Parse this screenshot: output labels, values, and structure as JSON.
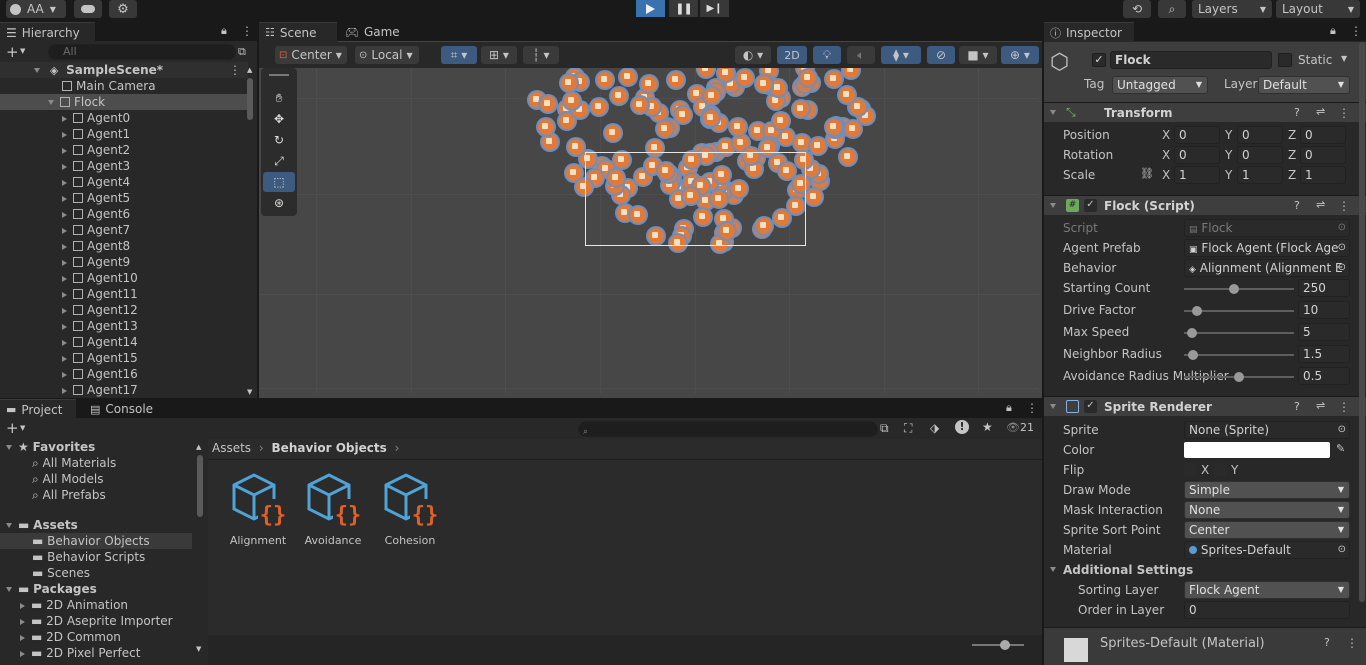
{
  "toolbar": {
    "account": "AA",
    "layers": "Layers",
    "layout": "Layout"
  },
  "hierarchy": {
    "tab": "Hierarchy",
    "search_placeholder": "All",
    "scene": "SampleScene*",
    "main_camera": "Main Camera",
    "flock": "Flock",
    "agents": [
      "Agent0",
      "Agent1",
      "Agent2",
      "Agent3",
      "Agent4",
      "Agent5",
      "Agent6",
      "Agent7",
      "Agent8",
      "Agent9",
      "Agent10",
      "Agent11",
      "Agent12",
      "Agent13",
      "Agent14",
      "Agent15",
      "Agent16",
      "Agent17"
    ]
  },
  "scene": {
    "tab_scene": "Scene",
    "tab_game": "Game",
    "pivot": "Center",
    "space": "Local",
    "mode_2d": "2D"
  },
  "project": {
    "tab_project": "Project",
    "tab_console": "Console",
    "hidden_count": "21",
    "favorites": "Favorites",
    "fav_items": [
      "All Materials",
      "All Models",
      "All Prefabs"
    ],
    "assets": "Assets",
    "asset_items": [
      "Behavior Objects",
      "Behavior Scripts",
      "Scenes"
    ],
    "packages": "Packages",
    "package_items": [
      "2D Animation",
      "2D Aseprite Importer",
      "2D Common",
      "2D Pixel Perfect"
    ],
    "breadcrumb_root": "Assets",
    "breadcrumb_current": "Behavior Objects",
    "files": [
      "Alignment",
      "Avoidance",
      "Cohesion"
    ]
  },
  "inspector": {
    "tab": "Inspector",
    "object_name": "Flock",
    "static_label": "Static",
    "tag_label": "Tag",
    "tag_value": "Untagged",
    "layer_label": "Layer",
    "layer_value": "Default",
    "transform": {
      "title": "Transform",
      "rows": [
        {
          "label": "Position",
          "x": "0",
          "y": "0",
          "z": "0"
        },
        {
          "label": "Rotation",
          "x": "0",
          "y": "0",
          "z": "0"
        },
        {
          "label": "Scale",
          "x": "1",
          "y": "1",
          "z": "1"
        }
      ],
      "axis": [
        "X",
        "Y",
        "Z"
      ]
    },
    "flock_script": {
      "title": "Flock (Script)",
      "script_label": "Script",
      "script_value": "Flock",
      "agent_prefab_label": "Agent Prefab",
      "agent_prefab_value": "Flock Agent (Flock Age",
      "behavior_label": "Behavior",
      "behavior_value": "Alignment (Alignment E",
      "sliders": [
        {
          "label": "Starting Count",
          "value": "250",
          "fraction": 0.45
        },
        {
          "label": "Drive Factor",
          "value": "10",
          "fraction": 0.12
        },
        {
          "label": "Max Speed",
          "value": "5",
          "fraction": 0.07
        },
        {
          "label": "Neighbor Radius",
          "value": "1.5",
          "fraction": 0.08
        },
        {
          "label": "Avoidance Radius Multiplier",
          "value": "0.5",
          "fraction": 0.5
        }
      ]
    },
    "sprite_renderer": {
      "title": "Sprite Renderer",
      "sprite_label": "Sprite",
      "sprite_value": "None (Sprite)",
      "color_label": "Color",
      "color_value": "#ffffff",
      "flip_label": "Flip",
      "flip_x": "X",
      "flip_y": "Y",
      "draw_mode_label": "Draw Mode",
      "draw_mode_value": "Simple",
      "mask_label": "Mask Interaction",
      "mask_value": "None",
      "sort_point_label": "Sprite Sort Point",
      "sort_point_value": "Center",
      "material_label": "Material",
      "material_value": "Sprites-Default",
      "additional": "Additional Settings",
      "sorting_layer_label": "Sorting Layer",
      "sorting_layer_value": "Flock Agent",
      "order_label": "Order in Layer",
      "order_value": "0"
    },
    "material_footer": "Sprites-Default (Material)"
  },
  "colors": {
    "accent": "#3a72b0",
    "asset_icon_blue": "#4fa3d6",
    "asset_icon_orange": "#e0602a"
  }
}
